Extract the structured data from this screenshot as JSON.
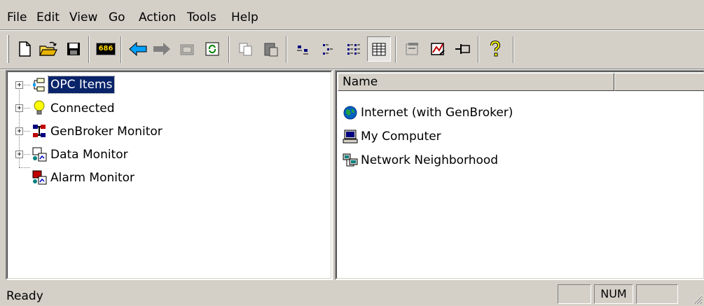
{
  "menu": [
    "File",
    "Edit",
    "View",
    "Go",
    "Action",
    "Tools",
    "Help"
  ],
  "toolbar": {
    "buttons": [
      {
        "name": "new-document-icon"
      },
      {
        "name": "open-folder-icon"
      },
      {
        "name": "save-disk-icon"
      },
      {
        "name": "cpu-686-icon",
        "text": "686"
      },
      {
        "name": "back-arrow-icon"
      },
      {
        "name": "forward-arrow-icon"
      },
      {
        "name": "up-folder-icon"
      },
      {
        "name": "refresh-icon"
      },
      {
        "name": "copy-icon"
      },
      {
        "name": "paste-icon"
      },
      {
        "name": "large-icons-view-icon"
      },
      {
        "name": "small-icons-view-icon"
      },
      {
        "name": "list-view-icon"
      },
      {
        "name": "details-view-icon"
      },
      {
        "name": "properties-icon"
      },
      {
        "name": "graph-icon"
      },
      {
        "name": "pin-icon"
      },
      {
        "name": "help-question-icon"
      }
    ]
  },
  "tree": {
    "items": [
      {
        "label": "OPC Items",
        "icon": "opc-items-icon",
        "expander": "+",
        "selected": true
      },
      {
        "label": "Connected",
        "icon": "lightbulb-icon",
        "expander": "+"
      },
      {
        "label": "GenBroker Monitor",
        "icon": "genbroker-monitor-icon",
        "expander": "+"
      },
      {
        "label": "Data Monitor",
        "icon": "data-monitor-icon",
        "expander": "+"
      },
      {
        "label": "Alarm Monitor",
        "icon": "alarm-monitor-icon"
      }
    ]
  },
  "list": {
    "column_header": "Name",
    "items": [
      {
        "label": "Internet (with GenBroker)",
        "icon": "globe-icon"
      },
      {
        "label": "My Computer",
        "icon": "computer-icon"
      },
      {
        "label": "Network Neighborhood",
        "icon": "network-icon"
      }
    ]
  },
  "status": {
    "text": "Ready",
    "num": "NUM"
  },
  "colors": {
    "face": "#d4d0c8",
    "selection": "#0a246a",
    "arrow": "#00a0ff"
  }
}
